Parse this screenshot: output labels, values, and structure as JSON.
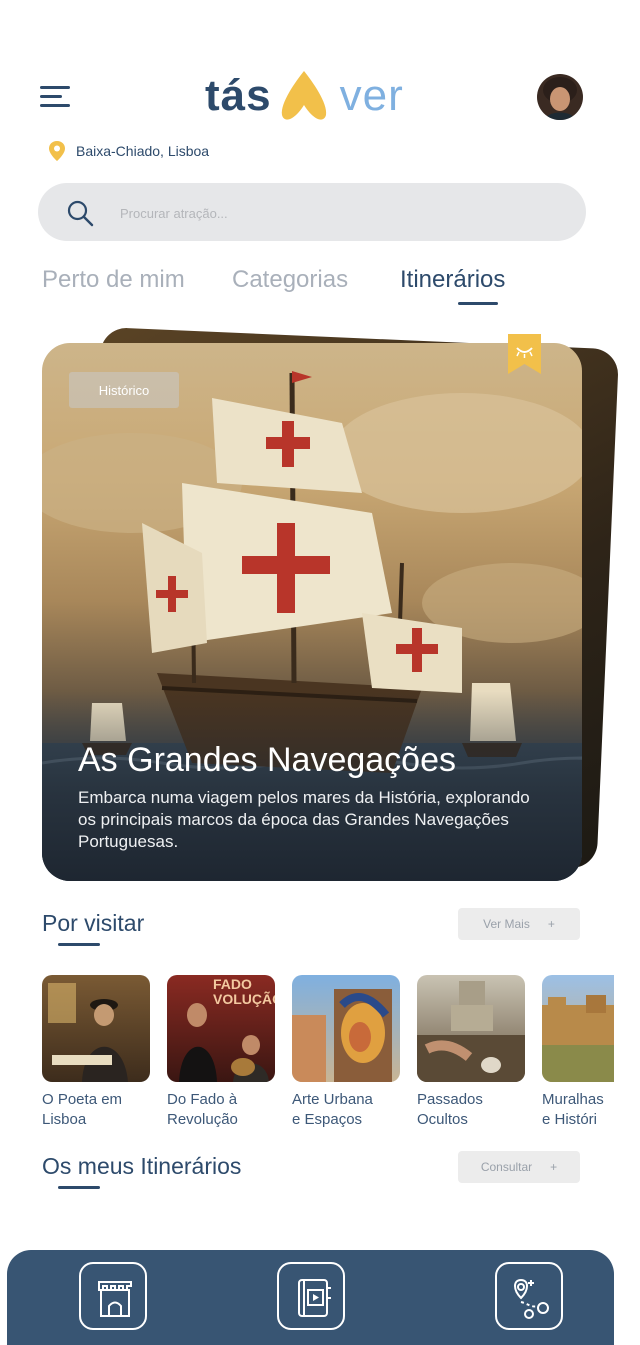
{
  "header": {
    "logo_part1": "tás",
    "logo_part2": "ver"
  },
  "location": {
    "text": "Baixa-Chiado, Lisboa"
  },
  "search": {
    "placeholder": "Procurar atração..."
  },
  "tabs": [
    {
      "label": "Perto de mim",
      "active": false
    },
    {
      "label": "Categorias",
      "active": false
    },
    {
      "label": "Itinerários",
      "active": true
    }
  ],
  "featured": {
    "badge": "Histórico",
    "title": "As Grandes Navegações",
    "description": "Embarca numa viagem pelos mares da História, explorando os principais marcos da época das Grandes Navegações Portuguesas."
  },
  "to_visit": {
    "title": "Por visitar",
    "more_label": "Ver Mais",
    "more_icon": "+",
    "items": [
      {
        "label": "O Poeta em\nLisboa"
      },
      {
        "label": "Do Fado à\nRevolução",
        "image_text": "FADO\nVOLUÇÃO"
      },
      {
        "label": "Arte Urbana\ne Espaços"
      },
      {
        "label": "Passados\nOcultos"
      },
      {
        "label": "Muralhas\ne Históri"
      }
    ]
  },
  "my_itineraries": {
    "title": "Os meus Itinerários",
    "consult_label": "Consultar",
    "consult_icon": "+"
  },
  "bottom_nav": {
    "icons": [
      "castle-icon",
      "photo-album-icon",
      "route-map-icon"
    ]
  },
  "colors": {
    "primary": "#2d4a6b",
    "accent_blue": "#7fb0e0",
    "accent_yellow": "#f2c04a",
    "nav_bg": "#385573"
  }
}
